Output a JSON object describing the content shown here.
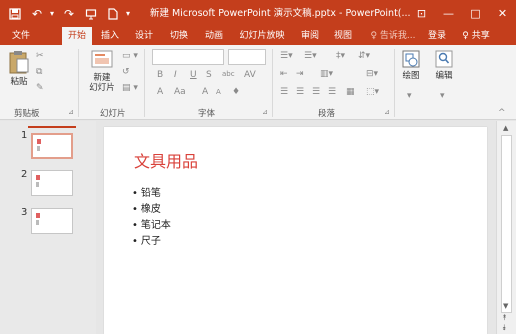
{
  "window": {
    "title": "新建 Microsoft PowerPoint 演示文稿.pptx - PowerPoint(...",
    "quick_access": [
      "save-icon",
      "undo-icon",
      "redo-icon",
      "present-icon",
      "new-file-icon"
    ],
    "controls": {
      "ribbon_display": "⊡",
      "minimize": "—",
      "maximize": "□",
      "close": "✕"
    }
  },
  "tabs": [
    "文件",
    "开始",
    "插入",
    "设计",
    "切换",
    "动画",
    "幻灯片放映",
    "审阅",
    "视图"
  ],
  "active_tab": "开始",
  "tell_me": "♀ 告诉我...",
  "account": {
    "login": "登录",
    "share": "♀ 共享"
  },
  "ribbon": {
    "clipboard": {
      "paste": "粘贴",
      "label": "剪贴板"
    },
    "slides": {
      "new_slide": "新建\n幻灯片",
      "new_slide_label": "新建幻灯片 ▾",
      "label": "幻灯片"
    },
    "font": {
      "label": "字体",
      "bold": "B",
      "italic": "I",
      "underline": "U",
      "strike": "S",
      "spacing": "abc",
      "aa": "Aa",
      "bigger": "A",
      "smaller": "A"
    },
    "paragraph": {
      "label": "段落"
    },
    "drawing": {
      "label": "绘图"
    },
    "editing": {
      "label": "编辑"
    }
  },
  "thumbnails": [
    {
      "number": "1"
    },
    {
      "number": "2"
    },
    {
      "number": "3"
    }
  ],
  "slide": {
    "title": "文具用品",
    "bullets": [
      "铅笔",
      "橡皮",
      "笔记本",
      "尺子"
    ]
  },
  "colors": {
    "accent": "#c43e1c",
    "title_text": "#d9413a"
  }
}
